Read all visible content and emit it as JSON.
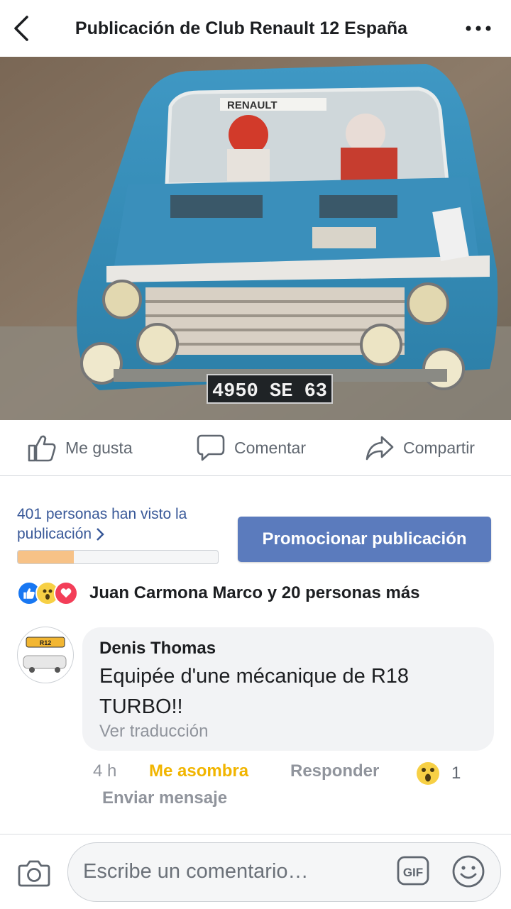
{
  "header": {
    "title": "Publicación de Club Renault 12 España"
  },
  "photo": {
    "plate": "4950 SE 63",
    "brand": "RENAULT"
  },
  "actions": {
    "like": "Me gusta",
    "comment": "Comentar",
    "share": "Compartir"
  },
  "stats": {
    "views_line1": "401 personas han visto la",
    "views_line2": "publicación",
    "views_progress": 0.28,
    "promote_label": "Promocionar publicación"
  },
  "reactions": {
    "text": "Juan Carmona Marco y 20 personas más",
    "icons": [
      "like-icon",
      "wow-icon",
      "love-icon"
    ]
  },
  "comment": {
    "author": "Denis Thomas",
    "text": "Equipée d'une mécanique de R18 TURBO!!",
    "translate": "Ver traducción",
    "avatar_badge": "R12",
    "time": "4 h",
    "reaction_label": "Me asombra",
    "reply_label": "Responder",
    "reaction_count": "1",
    "message_label": "Enviar mensaje"
  },
  "composer": {
    "placeholder": "Escribe un comentario…",
    "gif_label": "GIF"
  },
  "colors": {
    "link": "#385898",
    "promote": "#5b7bbd",
    "wow": "#f1b500",
    "like": "#1877f2",
    "love": "#f33e58"
  }
}
